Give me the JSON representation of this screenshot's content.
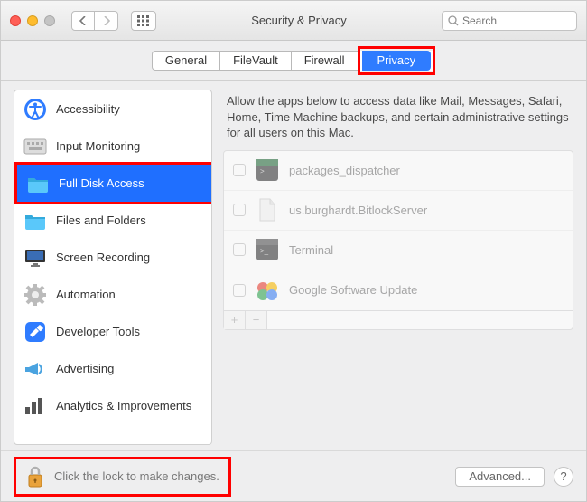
{
  "window": {
    "title": "Security & Privacy",
    "search_placeholder": "Search"
  },
  "tabs": {
    "general": "General",
    "filevault": "FileVault",
    "firewall": "Firewall",
    "privacy": "Privacy"
  },
  "sidebar": {
    "items": [
      {
        "label": "Accessibility"
      },
      {
        "label": "Input Monitoring"
      },
      {
        "label": "Full Disk Access"
      },
      {
        "label": "Files and Folders"
      },
      {
        "label": "Screen Recording"
      },
      {
        "label": "Automation"
      },
      {
        "label": "Developer Tools"
      },
      {
        "label": "Advertising"
      },
      {
        "label": "Analytics & Improvements"
      }
    ]
  },
  "main": {
    "description": "Allow the apps below to access data like Mail, Messages, Safari, Home, Time Machine backups, and certain administrative settings for all users on this Mac.",
    "apps": [
      {
        "label": "packages_dispatcher"
      },
      {
        "label": "us.burghardt.BitlockServer"
      },
      {
        "label": "Terminal"
      },
      {
        "label": "Google Software Update"
      }
    ],
    "add": "+",
    "remove": "−"
  },
  "footer": {
    "lock_text": "Click the lock to make changes.",
    "advanced": "Advanced...",
    "help": "?"
  }
}
